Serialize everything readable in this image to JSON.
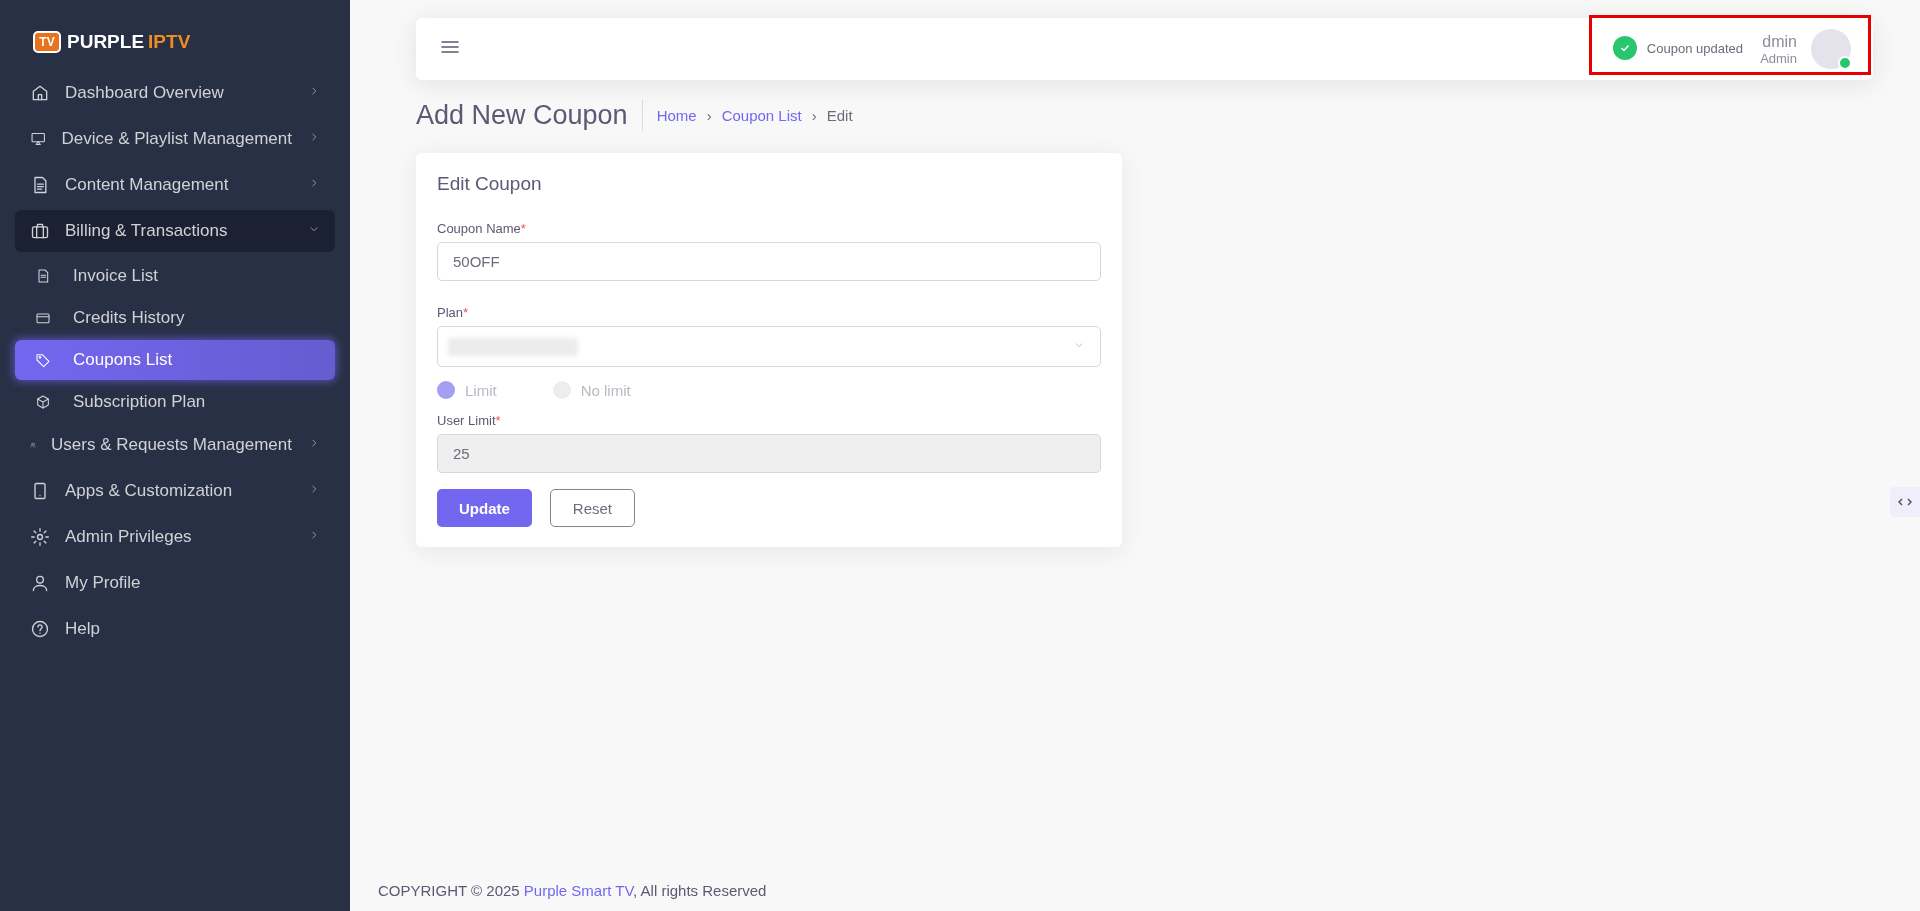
{
  "brand": {
    "name_part1": "PURPLE",
    "name_part2": "IPTV",
    "badge": "TV"
  },
  "sidebar": {
    "items": [
      {
        "label": "Dashboard Overview",
        "submenu": true,
        "expanded": false
      },
      {
        "label": "Device & Playlist Management",
        "submenu": true,
        "expanded": false
      },
      {
        "label": "Content Management",
        "submenu": true,
        "expanded": false
      },
      {
        "label": "Billing & Transactions",
        "submenu": true,
        "expanded": true,
        "children": [
          {
            "label": "Invoice List",
            "selected": false
          },
          {
            "label": "Credits History",
            "selected": false
          },
          {
            "label": "Coupons List",
            "selected": true
          },
          {
            "label": "Subscription Plan",
            "selected": false
          }
        ]
      },
      {
        "label": "Users & Requests Management",
        "submenu": true,
        "expanded": false
      },
      {
        "label": "Apps & Customization",
        "submenu": true,
        "expanded": false
      },
      {
        "label": "Admin Privileges",
        "submenu": true,
        "expanded": false
      },
      {
        "label": "My Profile",
        "submenu": false,
        "expanded": false
      },
      {
        "label": "Help",
        "submenu": false,
        "expanded": false
      }
    ]
  },
  "header": {
    "user_name": "dmin",
    "user_role": "Admin",
    "online": true
  },
  "toast": {
    "message": "Coupon updated"
  },
  "page": {
    "title": "Add New Coupon",
    "breadcrumb": [
      {
        "label": "Home",
        "link": true
      },
      {
        "label": "Coupon List",
        "link": true
      },
      {
        "label": "Edit",
        "link": false
      }
    ],
    "separator": "›"
  },
  "form": {
    "title": "Edit Coupon",
    "required_mark": "*",
    "coupon_name": {
      "label": "Coupon Name",
      "value": "50OFF"
    },
    "plan": {
      "label": "Plan"
    },
    "limit_options": [
      {
        "label": "Limit",
        "selected": true
      },
      {
        "label": "No limit",
        "selected": false
      }
    ],
    "user_limit": {
      "label": "User Limit",
      "value": "25",
      "disabled": true
    },
    "buttons": [
      {
        "label": "Update",
        "kind": "primary"
      },
      {
        "label": "Reset",
        "kind": "outline"
      }
    ]
  },
  "footer": {
    "prefix": "COPYRIGHT © 2025 ",
    "link": "Purple Smart TV",
    "suffix": ", All rights Reserved"
  }
}
